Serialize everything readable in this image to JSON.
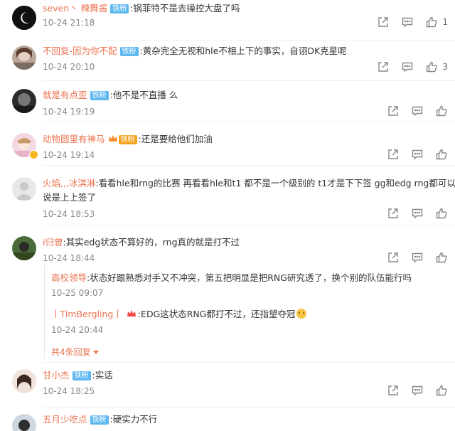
{
  "comments": [
    {
      "name": "seven丶 辣舞酱",
      "badge": "铁粉",
      "text": ":锅菲特不是去操控大盘了吗",
      "time": "10-24 21:18",
      "likes": "1"
    },
    {
      "name": "不回复-因为你不配",
      "badge": "铁粉",
      "text": ":黄杂完全无视和hle不相上下的事实，自诩DK克星呢",
      "time": "10-24 20:10",
      "likes": "3"
    },
    {
      "name": "就是有点歪",
      "badge": "铁粉",
      "text": ":他不是不直播 么",
      "time": "10-24 19:19",
      "likes": ""
    },
    {
      "name": "动物圆里有神马",
      "badge": "铁粉",
      "text": ":还是要给他们加油",
      "time": "10-24 19:14",
      "likes": ""
    },
    {
      "name": "火焰,,,冰淇淋",
      "badge": "",
      "text": ":看看hle和rng的比赛 再看看hle和t1 都不是一个级别的 t1才是下下签 gg和edg rng都可以",
      "text2": "说是上上签了",
      "time": "10-24 18:53",
      "likes": ""
    },
    {
      "name": "i归曾",
      "badge": "",
      "text": ":其实edg状态不算好的，rng真的就是打不过",
      "time": "10-24 18:44",
      "likes": ""
    },
    {
      "name": "甘小杰",
      "badge": "铁粉",
      "text": ":实话",
      "time": "10-24 18:25",
      "likes": ""
    },
    {
      "name": "五月少吃点",
      "badge": "铁粉",
      "text": ":硬实力不行",
      "time": "",
      "likes": ""
    }
  ],
  "replies": [
    {
      "name": "高校领导",
      "text": ":状态好跟熟悉对手又不冲突，第五把明显是把RNG研究透了，换个别的队伍能行吗",
      "time": "10-25 09:07"
    },
    {
      "name": "丨TimBergling丨",
      "text": ":EDG这状态RNG都打不过，还指望夺冠",
      "time": "10-24 20:44"
    }
  ],
  "more_replies": "共4条回复",
  "colors": {
    "name": "#eb7350",
    "badge": "#5fb8f0",
    "meta": "#888888"
  },
  "icons": [
    "share-icon",
    "comment-icon",
    "like-icon"
  ]
}
